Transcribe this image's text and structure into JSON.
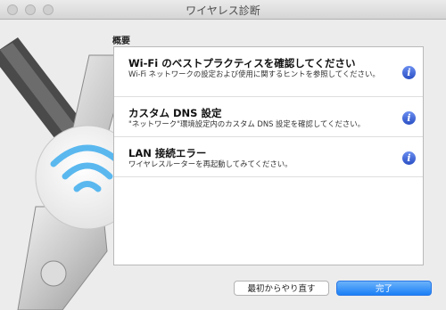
{
  "window": {
    "title": "ワイヤレス診断"
  },
  "section": {
    "label": "概要"
  },
  "items": [
    {
      "title": "Wi-Fi のベストプラクティスを確認してください",
      "desc": "Wi-Fi ネットワークの設定および使用に関するヒントを参照してください。"
    },
    {
      "title": "カスタム DNS 設定",
      "desc": "\"ネットワーク\"環境設定内のカスタム DNS 設定を確認してください。"
    },
    {
      "title": "LAN 接続エラー",
      "desc": "ワイヤレスルーターを再起動してみてください。"
    }
  ],
  "buttons": {
    "restart": "最初からやり直す",
    "done": "完了"
  },
  "colors": {
    "accent": "#1b7ff6",
    "info": "#2a4fc4",
    "wifi": "#5ab8ef"
  },
  "icons": {
    "info": "info-icon",
    "app": "wireless-diagnostics-icon"
  }
}
